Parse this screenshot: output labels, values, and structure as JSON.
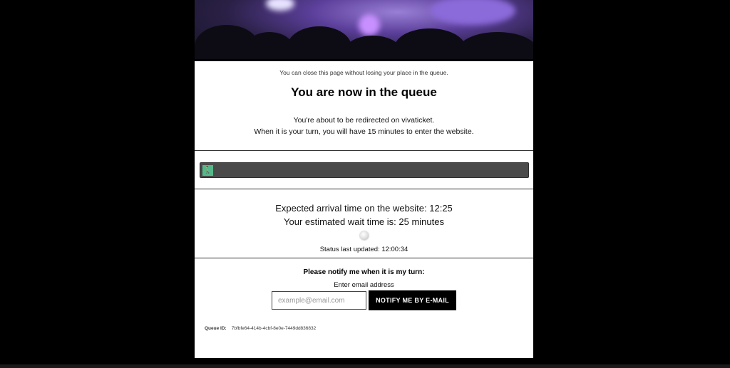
{
  "queue": {
    "close_note": "You can close this page without losing your place in the queue.",
    "title": "You are now in the queue",
    "redirect_line": "You're about to be redirected on vivaticket.",
    "turn_line": "When it is your turn, you will have 15 minutes to enter the website.",
    "progress": 0.0,
    "walker_icon": "person-walking-icon",
    "arrival_text": "Expected arrival time on the website: 12:25",
    "wait_text": "Your estimated wait time is: 25 minutes",
    "status_text": "Status last updated: 12:00:34"
  },
  "notify": {
    "title": "Please notify me when it is my turn:",
    "email_label": "Enter email address",
    "email_placeholder": "example@email.com",
    "email_value": "",
    "button_label": "NOTIFY ME BY E-MAIL"
  },
  "footer": {
    "queue_id_label": "Queue ID:",
    "queue_id_value": "7bfbfe64-414b-4cbf-8e0e-7449dd836832"
  },
  "colors": {
    "background": "#000000",
    "card": "#ffffff",
    "progress_track": "#4a4a4a",
    "progress_accent": "#55b88a",
    "button": "#000000"
  }
}
